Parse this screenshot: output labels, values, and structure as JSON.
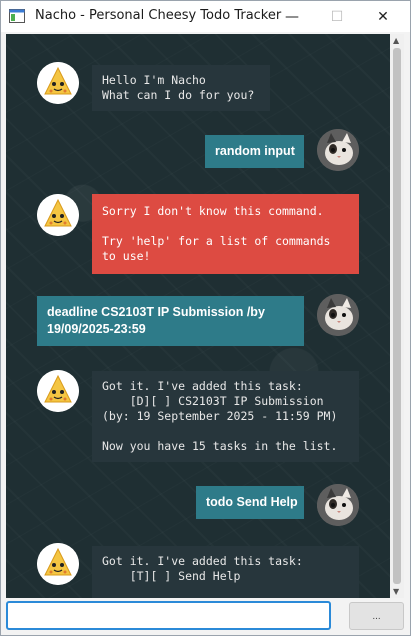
{
  "window": {
    "title": "Nacho - Personal Cheesy Todo Tracker",
    "minimize_glyph": "—",
    "maximize_glyph": "☐",
    "close_glyph": "✕"
  },
  "messages": [
    {
      "role": "bot",
      "text": "Hello I'm Nacho\nWhat can I do for you?"
    },
    {
      "role": "user",
      "text": "random input"
    },
    {
      "role": "error",
      "text": "Sorry I don't know this command.\n\nTry 'help' for a list of commands\nto use!"
    },
    {
      "role": "user",
      "text": "deadline CS2103T IP Submission /by 19/09/2025-23:59"
    },
    {
      "role": "bot",
      "text": "Got it. I've added this task:\n    [D][ ] CS2103T IP Submission\n(by: 19 September 2025 - 11:59 PM)\n\nNow you have 15 tasks in the list."
    },
    {
      "role": "user",
      "text": "todo Send Help"
    },
    {
      "role": "bot",
      "text": "Got it. I've added this task:\n    [T][ ] Send Help"
    }
  ],
  "input": {
    "value": "",
    "placeholder": ""
  },
  "send_button": {
    "label": "..."
  },
  "colors": {
    "chat_background": "#1f2f33",
    "bot_bubble": "#27363c",
    "error_bubble": "#dd4b42",
    "user_bubble": "#2e7b89",
    "input_border": "#2b8ad8"
  },
  "icons": {
    "bot_avatar": "nacho-chip-avatar-icon",
    "user_avatar": "cat-avatar-icon",
    "app": "app-window-icon"
  }
}
